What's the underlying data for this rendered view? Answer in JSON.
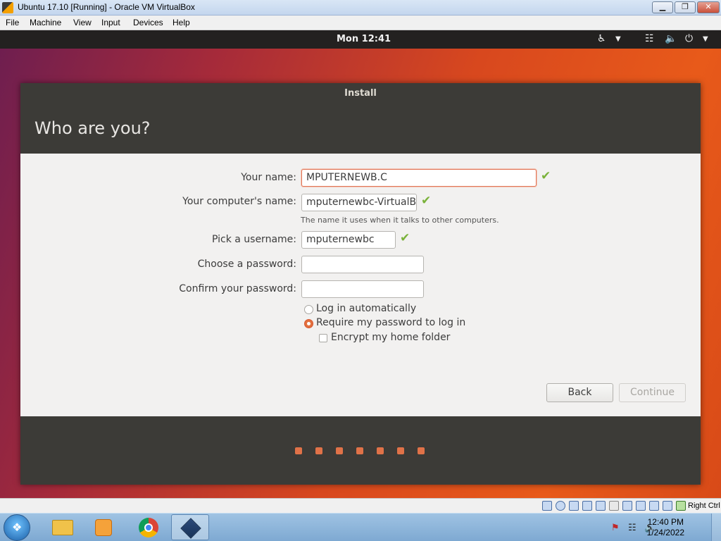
{
  "vbox": {
    "title": "Ubuntu 17.10 [Running] - Oracle VM VirtualBox",
    "menu": [
      "File",
      "Machine",
      "View",
      "Input",
      "Devices",
      "Help"
    ],
    "win_min": "▁",
    "win_max": "❐",
    "win_close": "✕",
    "host_key": "Right Ctrl"
  },
  "ubuntu": {
    "clock": "Mon 12:41"
  },
  "installer": {
    "title": "Install",
    "heading": "Who are you?",
    "your_name_label": "Your name:",
    "your_name_value": "MPUTERNEWB.C",
    "computer_name_label": "Your computer's name:",
    "computer_name_value": "mputernewbc-VirtualBox",
    "computer_name_hint": "The name it uses when it talks to other computers.",
    "username_label": "Pick a username:",
    "username_value": "mputernewbc",
    "password_label": "Choose a password:",
    "password_value": "",
    "confirm_label": "Confirm your password:",
    "confirm_value": "",
    "login_auto": "Log in automatically",
    "require_password": "Require my password to log in",
    "encrypt_home": "Encrypt my home folder",
    "back_label": "Back",
    "continue_label": "Continue",
    "progress_step": 7,
    "progress_total": 7
  },
  "taskbar": {
    "time": "12:40 PM",
    "date": "1/24/2022"
  },
  "colors": {
    "accent": "#e07248",
    "check": "#7ab23a",
    "header": "#3c3b37"
  }
}
